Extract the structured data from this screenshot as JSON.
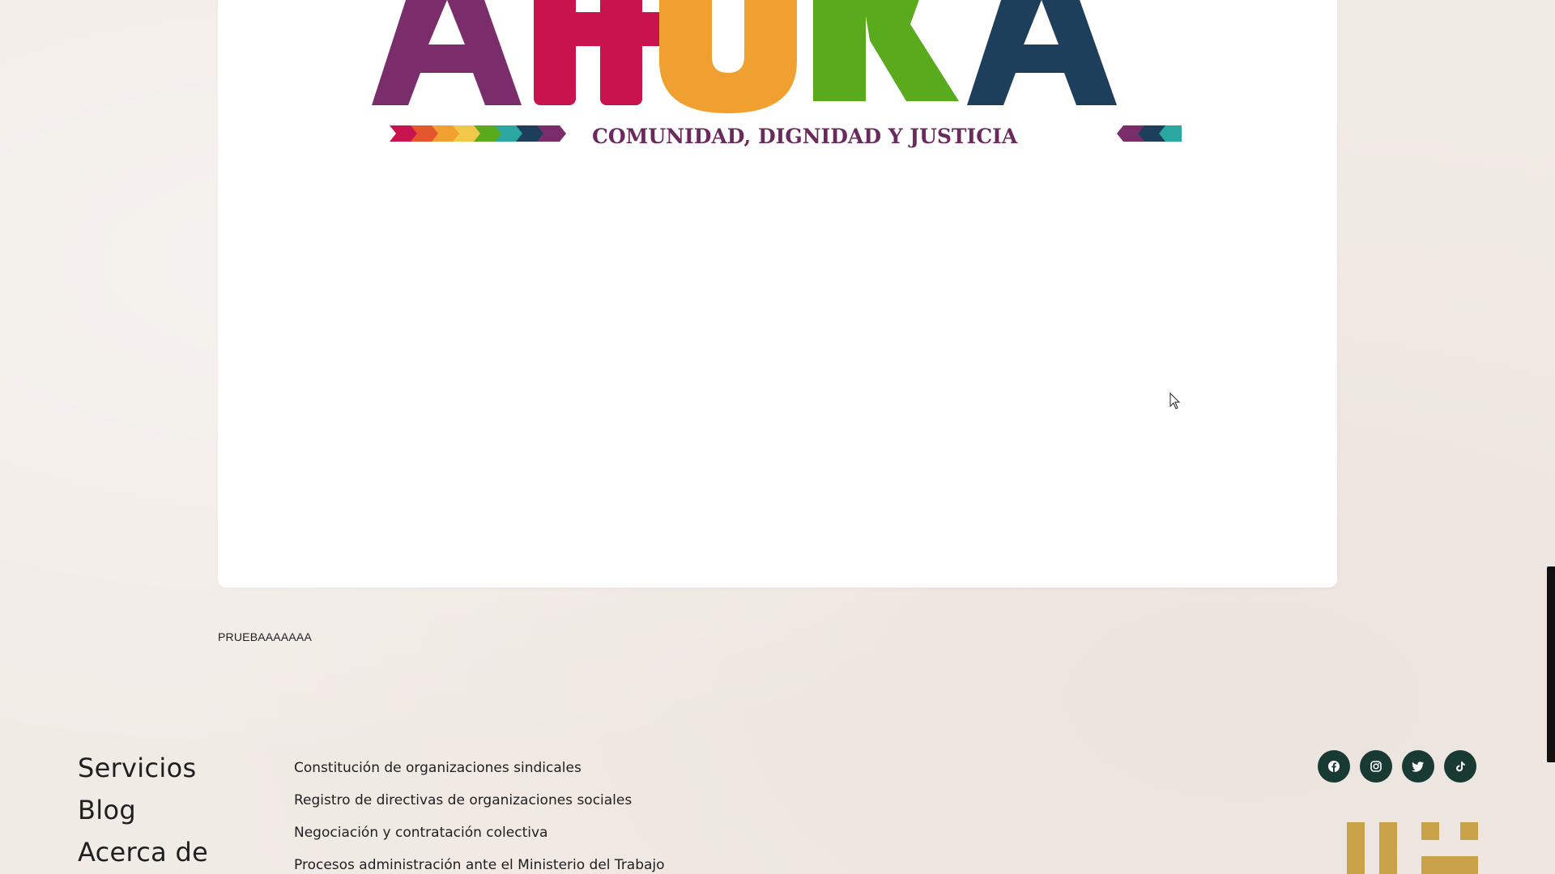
{
  "card": {
    "logo": {
      "word": "AHORA",
      "slogan": "COMUNIDAD, DIGNIDAD Y JUSTICIA",
      "colors": [
        "#7b2d6b",
        "#c8134f",
        "#f0a030",
        "#5aaa1e",
        "#1d3f5c"
      ]
    }
  },
  "test_text": "PRUEBAAAAAAA",
  "footer": {
    "nav": [
      {
        "label": "Servicios"
      },
      {
        "label": "Blog"
      },
      {
        "label": "Acerca de"
      }
    ],
    "services": [
      {
        "label": "Constitución de organizaciones sindicales"
      },
      {
        "label": "Registro de directivas de organizaciones sociales"
      },
      {
        "label": "Negociación y contratación colectiva"
      },
      {
        "label": "Procesos administración ante el Ministerio del Trabajo"
      }
    ],
    "socials": [
      {
        "name": "facebook-icon"
      },
      {
        "name": "instagram-icon"
      },
      {
        "name": "twitter-icon"
      },
      {
        "name": "tiktok-icon"
      }
    ],
    "accent_color": "#183a33",
    "brand_mark_color": "#c9a24a"
  }
}
